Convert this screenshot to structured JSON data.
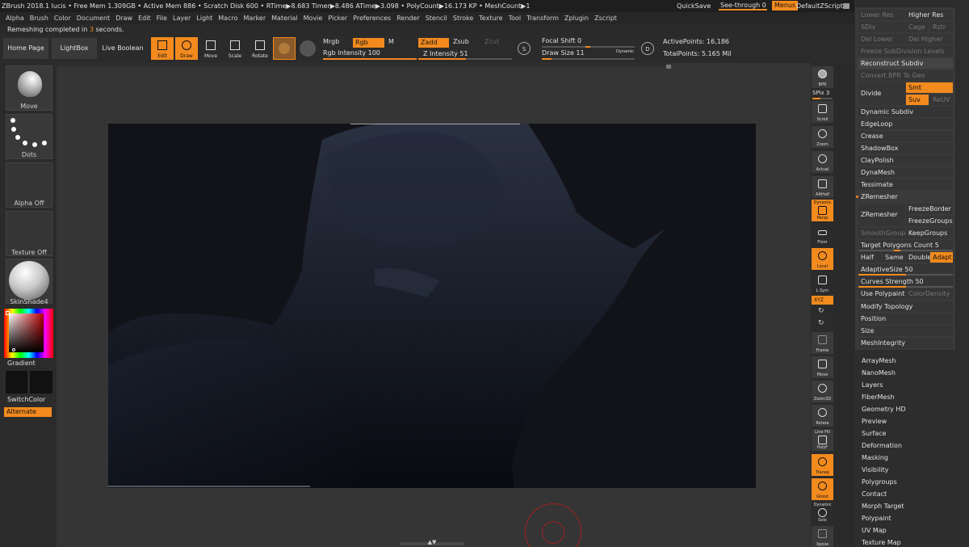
{
  "titlebar": {
    "text": "ZBrush 2018.1   lucis   • Free Mem 1.309GB • Active Mem 886 • Scratch Disk 600 • RTime▶8.683 Timer▶8.486 ATime▶3.098 • PolyCount▶16.173 KP • MeshCount▶1",
    "quicksave": "QuickSave",
    "see_through_label": "See-through  0",
    "menus": "Menus",
    "default_script": "DefaultZScript"
  },
  "menubar": [
    "Alpha",
    "Brush",
    "Color",
    "Document",
    "Draw",
    "Edit",
    "File",
    "Layer",
    "Light",
    "Macro",
    "Marker",
    "Material",
    "Movie",
    "Picker",
    "Preferences",
    "Render",
    "Stencil",
    "Stroke",
    "Texture",
    "Tool",
    "Transform",
    "Zplugin",
    "Zscript"
  ],
  "status": {
    "prefix": "Remeshing completed in ",
    "seconds": "3",
    "suffix": " seconds."
  },
  "toolbar": {
    "home": "Home Page",
    "lightbox": "LightBox",
    "live_boolean": "Live Boolean",
    "edit": "Edit",
    "draw": "Draw",
    "move": "Move",
    "scale": "Scale",
    "rotate": "Rotate",
    "mrgb": "Mrgb",
    "rgb": "Rgb",
    "m": "M",
    "zadd": "Zadd",
    "zsub": "Zsub",
    "zcut": "Zcut",
    "rgb_intensity": "Rgb Intensity 100",
    "rgb_intensity_value": 100,
    "z_intensity": "Z Intensity 51",
    "z_intensity_value": 51,
    "focal_shift": "Focal Shift 0",
    "focal_shift_value": 0,
    "draw_size": "Draw Size 11",
    "draw_size_value": 11,
    "dynamic": "Dynamic",
    "s_key": "S",
    "d_key": "D",
    "active_points": "ActivePoints: 16,186",
    "total_points": "TotalPoints: 5.165 Mil"
  },
  "leftshelf": {
    "brush": "Move",
    "stroke": "Dots",
    "alpha": "Alpha Off",
    "texture": "Texture Off",
    "material": "SkinShade4",
    "gradient": "Gradient",
    "switch_color": "SwitchColor",
    "alternate": "Alternate"
  },
  "rightshelf": {
    "bpr": "BPR",
    "spix": "SPix 3",
    "scroll": "Scroll",
    "zoom": "Zoom",
    "actual": "Actual",
    "aahalf": "AAHalf",
    "dynamic": "Dynamic",
    "persp": "Persp",
    "floor": "Floor",
    "local": "Local",
    "lsym": "L.Sym",
    "xyz": "XYZ",
    "frame": "Frame",
    "move": "Move",
    "zoom3d": "Zoom3D",
    "rotate": "Rotate",
    "linefill": "Line Fill",
    "polyf": "PolyF",
    "transp": "Transp",
    "ghost": "Ghost",
    "dynamic2": "Dynamic",
    "solo": "Solo",
    "xpose": "Xpose"
  },
  "geometry": {
    "lower_res": "Lower Res",
    "higher_res": "Higher Res",
    "sdiv": "SDiv",
    "cage": "Cage",
    "rstr": "Rstr",
    "del_lower": "Del Lower",
    "del_higher": "Del Higher",
    "freeze_subdiv": "Freeze SubDivision Levels",
    "reconstruct": "Reconstruct Subdiv",
    "convert_bpr": "Convert BPR To Geo",
    "divide": "Divide",
    "smt": "Smt",
    "suv": "Suv",
    "reuv": "ReUV",
    "dynamic_subdiv": "Dynamic Subdiv",
    "edgeloop": "EdgeLoop",
    "crease": "Crease",
    "shadowbox": "ShadowBox",
    "claypolish": "ClayPolish",
    "dynamesh": "DynaMesh",
    "tessimate": "Tessimate",
    "zremesher_head": "ZRemesher",
    "zremesher_btn": "ZRemesher",
    "freeze_border": "FreezeBorder",
    "freeze_groups": "FreezeGroups",
    "smooth_groups": "SmoothGroups",
    "keep_groups": "KeepGroups",
    "target_polygons": "Target Polygons Count 5",
    "target_polygons_value": 5,
    "half": "Half",
    "same": "Same",
    "double": "Double",
    "adapt": "Adapt",
    "adaptive_size": "AdaptiveSize 50",
    "adaptive_size_value": 50,
    "curves_strength": "Curves Strength 50",
    "curves_strength_value": 50,
    "use_polypaint": "Use Polypaint",
    "color_density": "ColorDensity",
    "modify_topology": "Modify Topology",
    "position": "Position",
    "size": "Size",
    "mesh_integrity": "MeshIntegrity"
  },
  "tool_subpalettes": [
    "ArrayMesh",
    "NanoMesh",
    "Layers",
    "FiberMesh",
    "Geometry HD",
    "Preview",
    "Surface",
    "Deformation",
    "Masking",
    "Visibility",
    "Polygroups",
    "Contact",
    "Morph Target",
    "Polypaint",
    "UV Map",
    "Texture Map"
  ],
  "colors": {
    "accent": "#f28a1e",
    "panel": "#3a3a3a",
    "bg": "#2a2a2a"
  }
}
